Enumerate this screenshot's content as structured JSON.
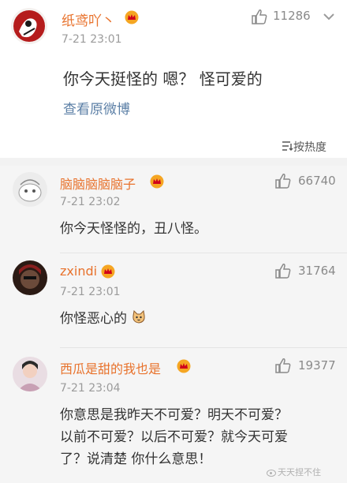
{
  "post": {
    "author": "纸鸢吖丶",
    "likes": "11286",
    "time": "7-21 23:01",
    "text": "你今天挺怪的 嗯？ 怪可爱的",
    "view_original": "查看原微博"
  },
  "sort": {
    "label": "按热度"
  },
  "comments": [
    {
      "author": "脑脑脑脑脑子",
      "likes": "66740",
      "time": "7-21 23:02",
      "text": "你今天怪怪的，丑八怪。"
    },
    {
      "author": "zxindi",
      "likes": "31764",
      "time": "7-21 23:01",
      "text": "你怪恶心的"
    },
    {
      "author": "西瓜是甜的我也是",
      "likes": "19377",
      "time": "7-21 23:04",
      "text_lines": [
        "你意思是我昨天不可爱？明天不可爱？",
        "以前不可爱？以后不可爱？就今天可爱",
        "了？说清楚 你什么意思！"
      ]
    }
  ],
  "watermark": "天天捏不住",
  "colors": {
    "accent": "#e8722c",
    "link": "#5b7fa6",
    "muted": "#9b9b9b"
  },
  "icons": [
    "crown-badge-icon",
    "thumbs-up-icon",
    "chevron-down-icon",
    "sort-icon",
    "cat-emoji-icon",
    "weibo-logo-icon"
  ]
}
